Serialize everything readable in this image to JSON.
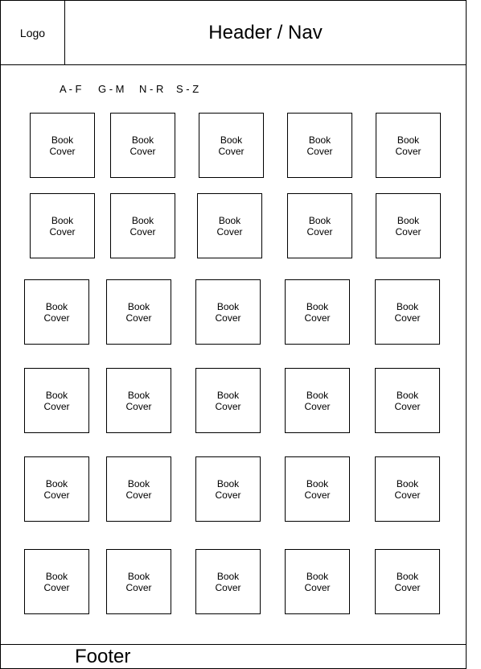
{
  "header": {
    "logo_label": "Logo",
    "title": "Header / Nav"
  },
  "alphabet_filter": [
    "A - F",
    "G - M",
    "N - R",
    "S - Z"
  ],
  "book_cover_label": "Book Cover",
  "grid": {
    "rows": 6,
    "columns": 5
  },
  "footer": {
    "label": "Footer"
  }
}
